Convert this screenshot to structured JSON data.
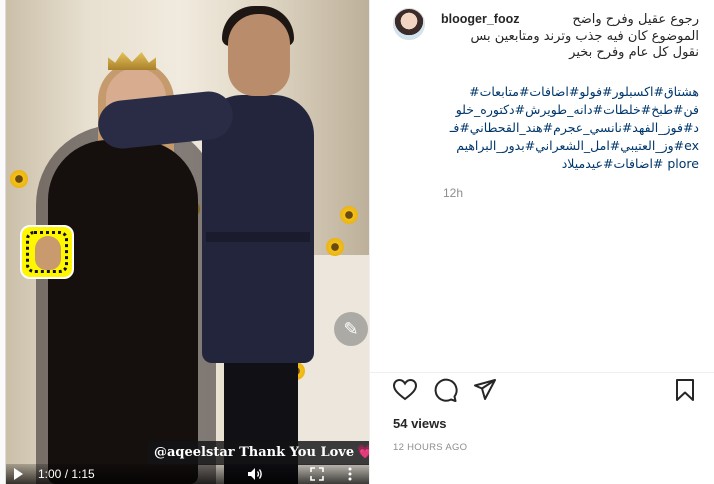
{
  "video": {
    "overlay_caption": "@aqeelstar Thank You Love",
    "overlay_heart": "💗",
    "time_display": "1:00 / 1:15",
    "progress_fraction": 0.8
  },
  "post": {
    "username": "blooger_fooz",
    "caption_lines": [
      "رجوع عقيل وفرح واضح",
      "الموضوع كان فيه جذب وترند ومتابعين بس",
      "نقول كل عام وفرح بخير"
    ],
    "hashtags": [
      "هشتاق#اكسبلور#فولو#اضافات#متابعات#",
      "فن#طبخ#خلطات#دانه_طويرش#دكتوره_خلو",
      "د#فوز_الفهد#نانسي_عجرم#هند_القحطاني#فـ",
      "ex#وز_العتيبي#امل_الشعراني#بدور_البراهيم",
      "plore #اضافات#عيدميلاد"
    ],
    "caption_time": "12h",
    "views": "54 views",
    "posted_ago": "12 HOURS AGO"
  },
  "icons": {
    "like": "heart-icon",
    "comment": "comment-icon",
    "share": "share-icon",
    "save": "bookmark-icon"
  }
}
